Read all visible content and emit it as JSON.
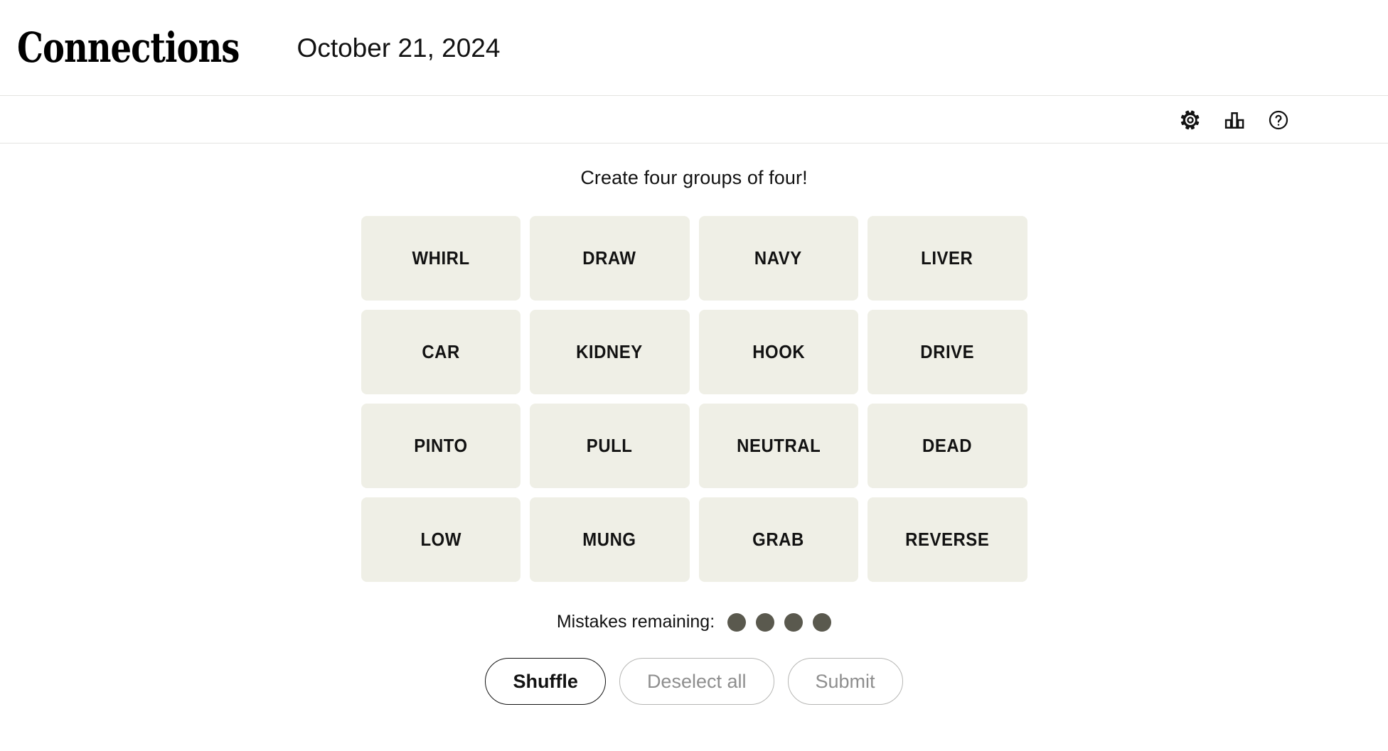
{
  "header": {
    "title": "Connections",
    "date": "October 21, 2024",
    "tools": [
      {
        "name": "settings",
        "icon": "gear-icon",
        "label": "Settings"
      },
      {
        "name": "stats",
        "icon": "bar-chart-icon",
        "label": "Statistics"
      },
      {
        "name": "help",
        "icon": "question-circle-icon",
        "label": "Help"
      }
    ]
  },
  "game": {
    "instruction": "Create four groups of four!",
    "tiles": [
      "WHIRL",
      "DRAW",
      "NAVY",
      "LIVER",
      "CAR",
      "KIDNEY",
      "HOOK",
      "DRIVE",
      "PINTO",
      "PULL",
      "NEUTRAL",
      "DEAD",
      "LOW",
      "MUNG",
      "GRAB",
      "REVERSE"
    ],
    "mistakes": {
      "label": "Mistakes remaining:",
      "remaining": 4,
      "dot_color": "#5A594E"
    },
    "actions": [
      {
        "name": "shuffle",
        "label": "Shuffle",
        "state": "enabled"
      },
      {
        "name": "deselect-all",
        "label": "Deselect all",
        "state": "disabled"
      },
      {
        "name": "submit",
        "label": "Submit",
        "state": "disabled"
      }
    ]
  },
  "colors": {
    "page_background": "#FFFFFF",
    "tile_background": "#EFEFE6",
    "text": "#121212",
    "divider": "#E3E3E1",
    "disabled_text": "#8E8E8E",
    "disabled_border": "#B6B6B4"
  }
}
